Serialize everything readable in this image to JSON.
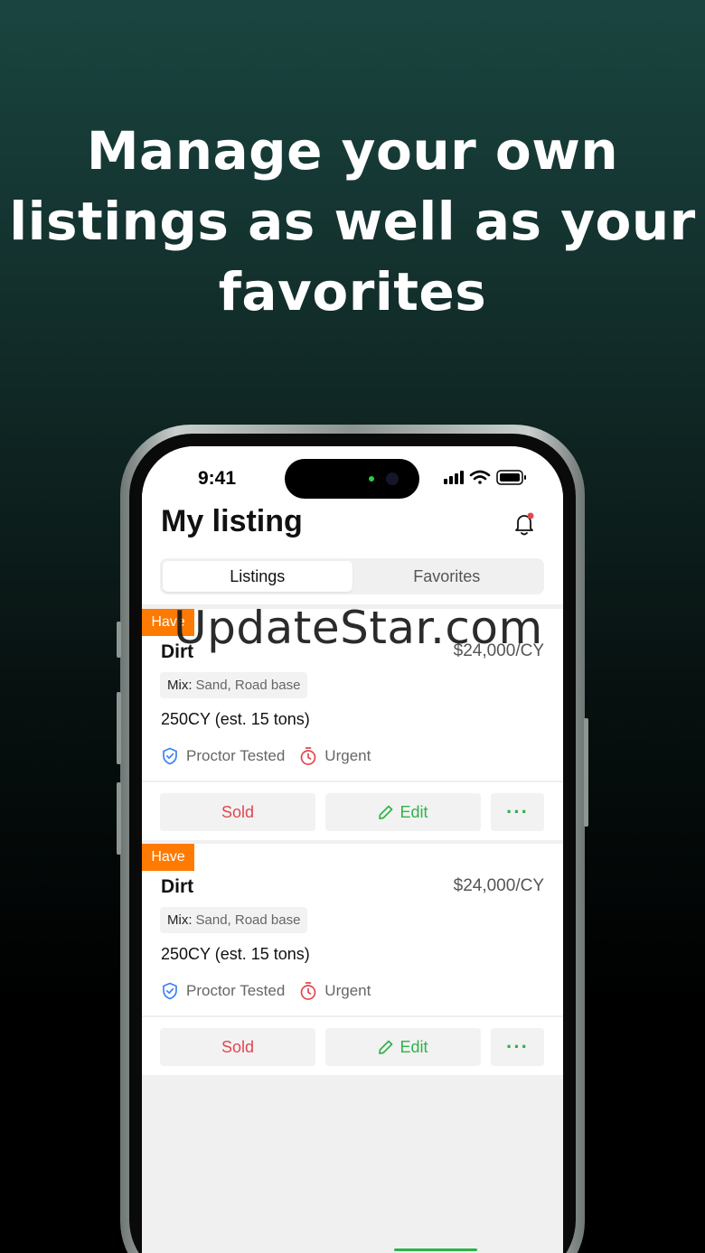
{
  "headline": {
    "line1": "Manage your own",
    "line2": "listings as well as your",
    "line3": "favorites"
  },
  "status_bar": {
    "time": "9:41"
  },
  "app": {
    "title": "My listing",
    "tabs": [
      {
        "label": "Listings",
        "active": true
      },
      {
        "label": "Favorites",
        "active": false
      }
    ],
    "listings": [
      {
        "badge": "Have",
        "name": "Dirt",
        "price": "$24,000/CY",
        "mix_label": "Mix:",
        "mix_value": "Sand, Road base",
        "quantity": "250CY (est. 15 tons)",
        "tags": [
          "Proctor Tested",
          "Urgent"
        ],
        "actions": {
          "sold": "Sold",
          "edit": "Edit",
          "more": "···"
        }
      },
      {
        "badge": "Have",
        "name": "Dirt",
        "price": "$24,000/CY",
        "mix_label": "Mix:",
        "mix_value": "Sand, Road base",
        "quantity": "250CY (est. 15 tons)",
        "tags": [
          "Proctor Tested",
          "Urgent"
        ],
        "actions": {
          "sold": "Sold",
          "edit": "Edit",
          "more": "···"
        }
      }
    ]
  },
  "watermark": "UpdateStar.com",
  "colors": {
    "badge": "#ff7a00",
    "sold": "#e0484f",
    "edit": "#2fb34a",
    "shield": "#3b82f6",
    "timer": "#e0484f",
    "notification_dot": "#e0484f"
  },
  "icons": [
    "signal-icon",
    "wifi-icon",
    "battery-icon",
    "bell-icon",
    "shield-check-icon",
    "stopwatch-icon",
    "pencil-icon",
    "more-dots-icon"
  ]
}
